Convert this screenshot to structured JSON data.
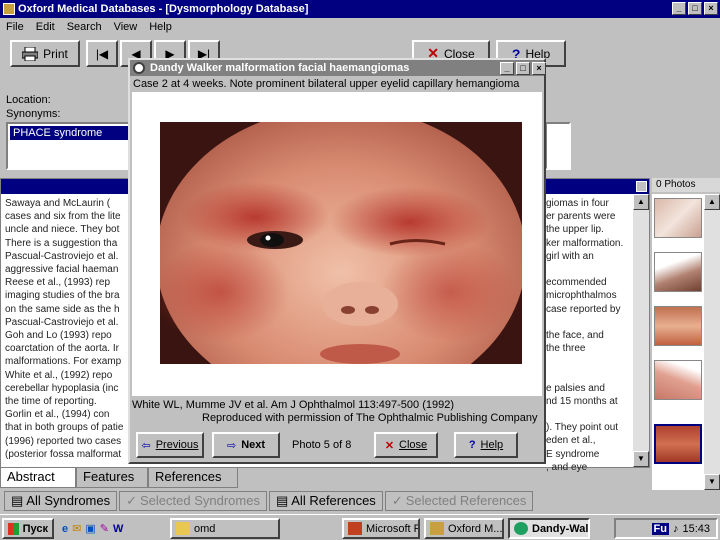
{
  "window": {
    "title": "Oxford Medical Databases - [Dysmorphology Database]"
  },
  "menu": [
    "File",
    "Edit",
    "Search",
    "View",
    "Help"
  ],
  "toolbar": {
    "print_label": "Print",
    "close_label": "Close",
    "help_label": "Help"
  },
  "location_label": "Location:",
  "synonyms_label": "Synonyms:",
  "synonym_selected": "PHACE syndrome",
  "abstract_lines": [
    "    Sawaya and McLaurin (",
    "cases and six from the lite",
    "uncle and niece. They bot",
    "There is a suggestion tha",
    "Pascual-Castroviejo et al.",
    "aggressive facial haeman",
    "    Reese et al., (1993) rep",
    "imaging studies of the bra",
    "on the same side as the h",
    "Pascual-Castroviejo et al.",
    "    Goh and Lo (1993) repo",
    "coarctation of the aorta. Ir",
    "malformations. For examp",
    "    White et al., (1992) repo",
    "cerebellar hypoplasia (inc",
    "the time of reporting.",
    "    Gorlin et al., (1994) con",
    "that in both groups of patie",
    "(1996) reported two cases",
    "(posterior fossa malformat"
  ],
  "abstract_lines_right": [
    "giomas in four",
    "er parents were",
    "the upper lip.",
    "ker malformation.",
    "girl with an",
    "",
    "ecommended",
    "microphthalmos",
    "case reported by",
    "",
    "the face, and",
    "the three",
    "",
    "",
    "e palsies and",
    "nd 15 months at",
    "",
    "). They point out",
    "eden et al.,",
    "E syndrome",
    ", and eye"
  ],
  "photos_panel": {
    "header": "0 Photos"
  },
  "tabs_top": [
    "Abstract",
    "Features",
    "References"
  ],
  "tabs_bottom": [
    "All Syndromes",
    "Selected Syndromes",
    "All References",
    "Selected References"
  ],
  "dialog": {
    "title": "Dandy Walker malformation facial haemangiomas",
    "caption": "Case 2 at 4 weeks. Note prominent bilateral upper eyelid capillary hemangioma",
    "citation": "White WL, Mumme JV et al. Am J Ophthalmol 113:497-500 (1992)",
    "permission": "Reproduced with permission of The Ophthalmic Publishing Company",
    "previous_label": "Previous",
    "next_label": "Next",
    "counter": "Photo 5 of 8",
    "close_label": "Close",
    "help_label": "Help"
  },
  "taskbar": {
    "start": "Пуск",
    "items": [
      "omd",
      "Microsoft P...",
      "Oxford M...",
      "Dandy-Wal..."
    ],
    "lang": "Fu",
    "clock": "15:43"
  }
}
